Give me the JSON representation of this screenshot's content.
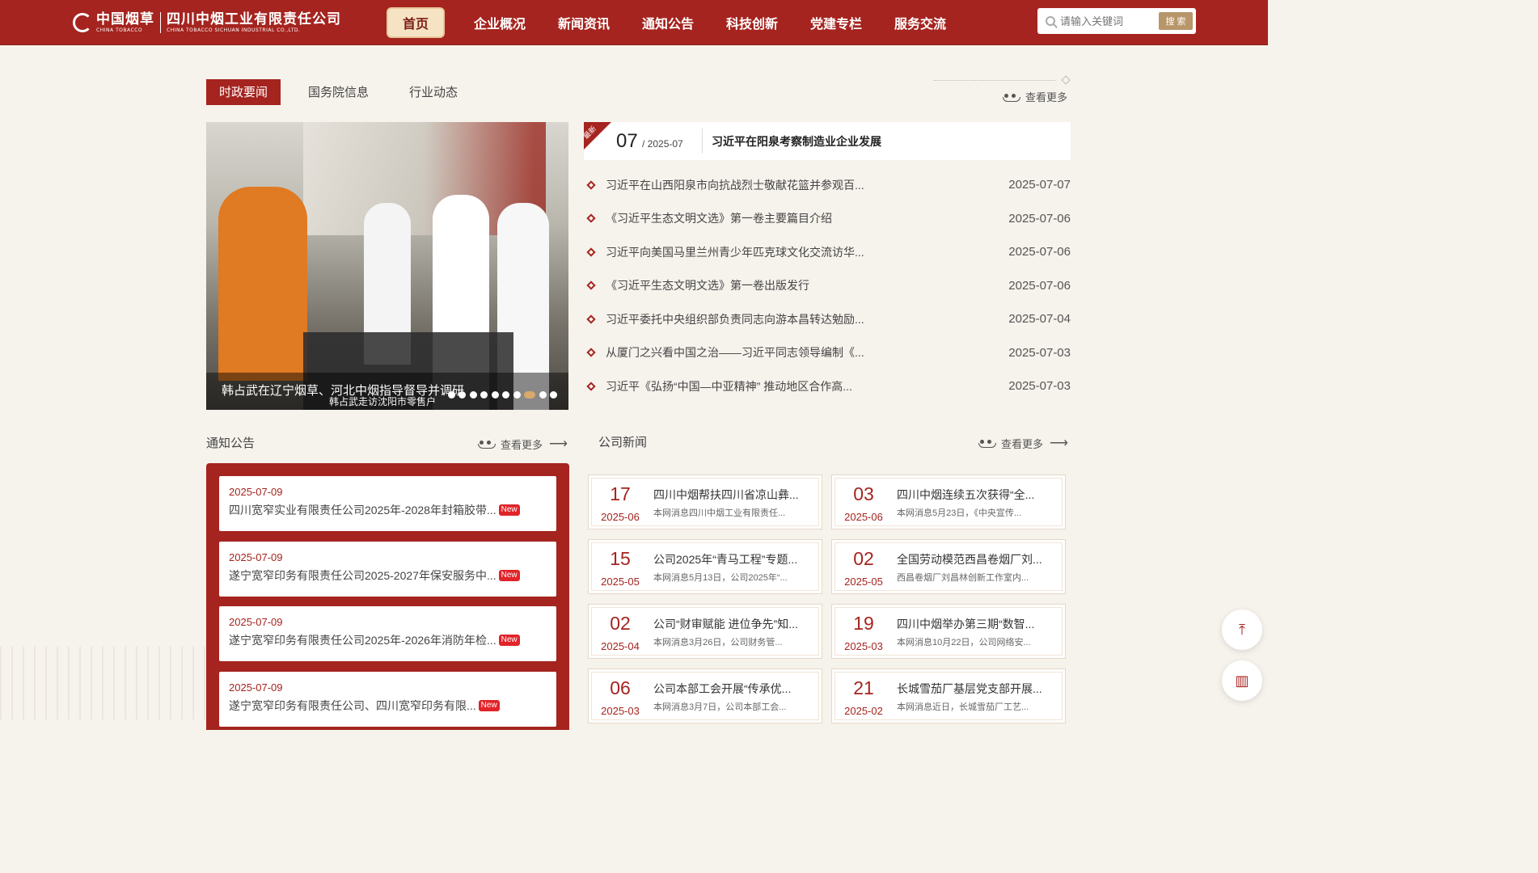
{
  "header": {
    "logo_cn": "中国烟草",
    "logo_en": "CHINA TOBACCO",
    "company_cn": "四川中烟工业有限责任公司",
    "company_en": "CHINA TOBACCO SICHUAN INDUSTRIAL CO.,LTD.",
    "nav": [
      "首页",
      "企业概况",
      "新闻资讯",
      "通知公告",
      "科技创新",
      "党建专栏",
      "服务交流"
    ],
    "search_placeholder": "请输入关键词",
    "search_button": "搜 索"
  },
  "politics": {
    "tabs": [
      "时政要闻",
      "国务院信息",
      "行业动态"
    ],
    "more": "查看更多",
    "slider": {
      "caption": "韩占武在辽宁烟草、河北中烟指导督导并调研",
      "subcaption": "韩占武走访沈阳市零售户",
      "dots_count": 10,
      "active_dot_index": 7
    },
    "headline": {
      "ribbon": "最新",
      "day": "07",
      "year_month": "/ 2025-07",
      "title": "习近平在阳泉考察制造业企业发展"
    },
    "list": [
      {
        "title": "习近平在山西阳泉市向抗战烈士敬献花篮并参观百...",
        "date": "2025-07-07"
      },
      {
        "title": "《习近平生态文明文选》第一卷主要篇目介绍",
        "date": "2025-07-06"
      },
      {
        "title": "习近平向美国马里兰州青少年匹克球文化交流访华...",
        "date": "2025-07-06"
      },
      {
        "title": "《习近平生态文明文选》第一卷出版发行",
        "date": "2025-07-06"
      },
      {
        "title": "习近平委托中央组织部负责同志向游本昌转达勉励...",
        "date": "2025-07-04"
      },
      {
        "title": "从厦门之兴看中国之治——习近平同志领导编制《...",
        "date": "2025-07-03"
      },
      {
        "title": "习近平《弘扬“中国—中亚精神” 推动地区合作高...",
        "date": "2025-07-03"
      }
    ]
  },
  "notices": {
    "title": "通知公告",
    "more": "查看更多",
    "items": [
      {
        "date": "2025-07-09",
        "title": "四川宽窄实业有限责任公司2025年-2028年封箱胶带...",
        "badge": "New"
      },
      {
        "date": "2025-07-09",
        "title": "遂宁宽窄印务有限责任公司2025-2027年保安服务中...",
        "badge": "New"
      },
      {
        "date": "2025-07-09",
        "title": "遂宁宽窄印务有限责任公司2025年-2026年消防年检...",
        "badge": "New"
      },
      {
        "date": "2025-07-09",
        "title": "遂宁宽窄印务有限责任公司、四川宽窄印务有限...",
        "badge": "New"
      }
    ]
  },
  "company_news": {
    "title": "公司新闻",
    "more": "查看更多",
    "items": [
      {
        "day": "17",
        "ym": "2025-06",
        "title": "四川中烟帮扶四川省凉山彝...",
        "summary": "本网消息四川中烟工业有限责任..."
      },
      {
        "day": "03",
        "ym": "2025-06",
        "title": "四川中烟连续五次获得“全...",
        "summary": "本网消息5月23日，《中央宣传..."
      },
      {
        "day": "15",
        "ym": "2025-05",
        "title": "公司2025年“青马工程”专题...",
        "summary": "本网消息5月13日，公司2025年“..."
      },
      {
        "day": "02",
        "ym": "2025-05",
        "title": "全国劳动模范西昌卷烟厂刘...",
        "summary": "西昌卷烟厂刘昌林创新工作室内..."
      },
      {
        "day": "02",
        "ym": "2025-04",
        "title": "公司“财审赋能 进位争先”知...",
        "summary": "本网消息3月26日，公司财务管..."
      },
      {
        "day": "19",
        "ym": "2025-03",
        "title": "四川中烟举办第三期“数智...",
        "summary": "本网消息10月22日，公司网络安..."
      },
      {
        "day": "06",
        "ym": "2025-03",
        "title": "公司本部工会开展“传承优...",
        "summary": "本网消息3月7日，公司本部工会..."
      },
      {
        "day": "21",
        "ym": "2025-02",
        "title": "长城雪茄厂基层党支部开展...",
        "summary": "本网消息近日，长城雪茄厂工艺..."
      }
    ]
  },
  "colors": {
    "brand": "#a5241f",
    "accent": "#b8966a",
    "background": "#f6f2ec"
  },
  "icons": {
    "back_top": "arrow-up-icon",
    "side_tool": "bookshelf-icon"
  }
}
